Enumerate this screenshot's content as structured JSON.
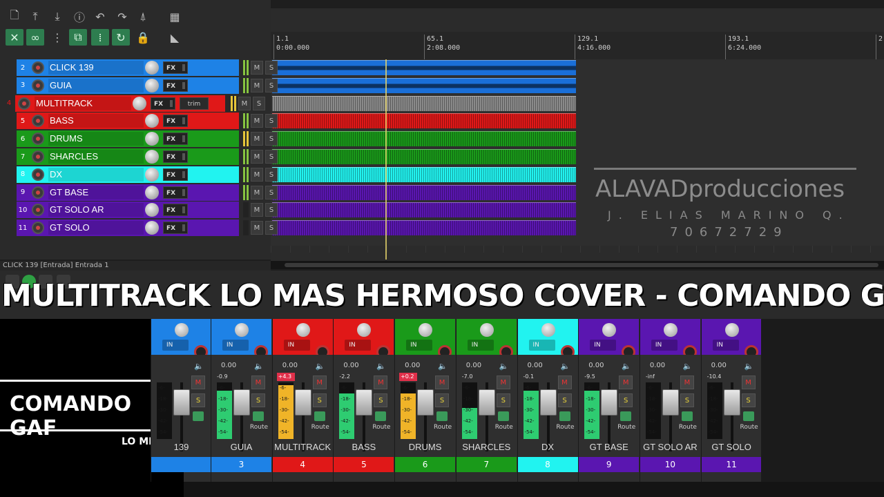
{
  "colors": {
    "blue": "#1e82e6",
    "red": "#e01818",
    "green": "#1a9a1a",
    "cyan": "#21f3f0",
    "purple": "#5a16b0",
    "waveform_blue": "#1a6fd8",
    "waveform_gray": "#8a8a8a"
  },
  "toolbar": {
    "icons": [
      "new-file-icon",
      "upload-icon",
      "download-icon",
      "info-icon",
      "undo-icon",
      "redo-icon",
      "metronome-icon",
      "grid-icon",
      "ripple-icon",
      "link-icon",
      "grid-snap-icon",
      "group-icon",
      "dots-icon",
      "loop-icon",
      "lock-icon",
      "envelope-icon"
    ]
  },
  "ruler": {
    "marks": [
      {
        "bar": "1.1",
        "time": "0:00.000"
      },
      {
        "bar": "65.1",
        "time": "2:08.000"
      },
      {
        "bar": "129.1",
        "time": "4:16.000"
      },
      {
        "bar": "193.1",
        "time": "6:24.000"
      },
      {
        "bar": "2",
        "time": ""
      }
    ]
  },
  "tracks": [
    {
      "num": "2",
      "name": "CLICK 139",
      "color": "#1e82e6",
      "fx": "FX",
      "m": "M",
      "s": "S"
    },
    {
      "num": "3",
      "name": "GUIA",
      "color": "#1e82e6",
      "fx": "FX",
      "m": "M",
      "s": "S"
    },
    {
      "num": "4",
      "name": "MULTITRACK",
      "color": "#e01818",
      "fx": "FX",
      "m": "M",
      "s": "S",
      "trim": "trim"
    },
    {
      "num": "5",
      "name": "BASS",
      "color": "#e01818",
      "fx": "FX",
      "m": "M",
      "s": "S"
    },
    {
      "num": "6",
      "name": "DRUMS",
      "color": "#1a9a1a",
      "fx": "FX",
      "m": "M",
      "s": "S"
    },
    {
      "num": "7",
      "name": "SHARCLES",
      "color": "#1a9a1a",
      "fx": "FX",
      "m": "M",
      "s": "S"
    },
    {
      "num": "8",
      "name": "DX",
      "color": "#21f3f0",
      "fx": "FX",
      "m": "M",
      "s": "S"
    },
    {
      "num": "9",
      "name": "GT BASE",
      "color": "#5a16b0",
      "fx": "FX",
      "m": "M",
      "s": "S"
    },
    {
      "num": "10",
      "name": "GT SOLO AR",
      "color": "#5a16b0",
      "fx": "FX",
      "m": "M",
      "s": "S"
    },
    {
      "num": "11",
      "name": "GT SOLO",
      "color": "#5a16b0",
      "fx": "FX",
      "m": "M",
      "s": "S"
    }
  ],
  "status": {
    "selected_track": "CLICK 139 [Entrada] Entrada 1"
  },
  "title": "MULTITRACK LO MAS HERMOSO COVER - COMANDO GAF",
  "watermark": {
    "brand": "ALAVADproducciones",
    "name": "J. ELIAS MARINO Q.",
    "phone": "70672729"
  },
  "brandbox": {
    "big": "COMANDO GAF",
    "small": "LO MEJOR"
  },
  "mixer": {
    "strips": [
      {
        "name": "139",
        "num": "",
        "color": "#1e82e6",
        "vol": "",
        "peak": "",
        "hot": false,
        "level": 0.0,
        "meter_color": "#2ecc71",
        "in": "IN",
        "route": ""
      },
      {
        "name": "GUIA",
        "num": "3",
        "color": "#1e82e6",
        "vol": "0.00",
        "peak": "-0.9",
        "hot": false,
        "level": 0.85,
        "meter_color": "#2ecc71",
        "in": "IN",
        "route": "Route"
      },
      {
        "name": "MULTITRACK",
        "num": "4",
        "color": "#e01818",
        "vol": "0.00",
        "peak": "+4.3",
        "hot": true,
        "level": 0.95,
        "meter_color": "#f0b428",
        "in": "IN",
        "route": "Route"
      },
      {
        "name": "BASS",
        "num": "5",
        "color": "#e01818",
        "vol": "0.00",
        "peak": "-2.2",
        "hot": false,
        "level": 0.8,
        "meter_color": "#2ecc71",
        "in": "IN",
        "route": "Route"
      },
      {
        "name": "DRUMS",
        "num": "6",
        "color": "#1a9a1a",
        "vol": "0.00",
        "peak": "+0.2",
        "hot": true,
        "level": 0.8,
        "meter_color": "#f0b428",
        "in": "IN",
        "route": "Route"
      },
      {
        "name": "SHARCLES",
        "num": "7",
        "color": "#1a9a1a",
        "vol": "0.00",
        "peak": "-7.0",
        "hot": false,
        "level": 0.55,
        "meter_color": "#2ecc71",
        "in": "IN",
        "route": "Route"
      },
      {
        "name": "DX",
        "num": "8",
        "color": "#21f3f0",
        "vol": "0.00",
        "peak": "-0.1",
        "hot": false,
        "level": 0.85,
        "meter_color": "#2ecc71",
        "in": "IN",
        "route": "Route"
      },
      {
        "name": "GT BASE",
        "num": "9",
        "color": "#5a16b0",
        "vol": "0.00",
        "peak": "-9.5",
        "hot": false,
        "level": 0.85,
        "meter_color": "#2ecc71",
        "in": "IN",
        "route": "Route"
      },
      {
        "name": "GT SOLO AR",
        "num": "10",
        "color": "#5a16b0",
        "vol": "0.00",
        "peak": "-inf",
        "hot": false,
        "level": 0.0,
        "meter_color": "#2ecc71",
        "in": "IN",
        "route": "Route"
      },
      {
        "name": "GT SOLO",
        "num": "11",
        "color": "#5a16b0",
        "vol": "0.00",
        "peak": "-10.4",
        "hot": false,
        "level": 0.0,
        "meter_color": "#2ecc71",
        "in": "IN",
        "route": "Route"
      }
    ],
    "scale": [
      "-6-",
      "-18-",
      "-30-",
      "-42-",
      "-54-"
    ]
  }
}
